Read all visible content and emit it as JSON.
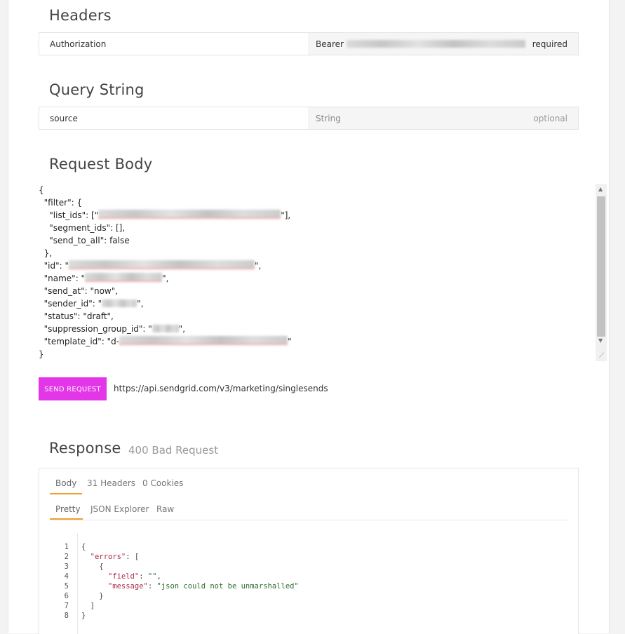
{
  "headers": {
    "title": "Headers",
    "rows": [
      {
        "name": "Authorization",
        "value": "Bearer",
        "requirement": "required"
      }
    ]
  },
  "query": {
    "title": "Query String",
    "rows": [
      {
        "name": "source",
        "value": "String",
        "requirement": "optional"
      }
    ]
  },
  "request_body": {
    "title": "Request Body",
    "lines": {
      "l1": "{",
      "l2": "  \"filter\": {",
      "l3a": "    \"list_ids\": [\"",
      "l3b": "\"],",
      "l4": "    \"segment_ids\": [],",
      "l5": "    \"send_to_all\": false",
      "l6": "  },",
      "l7a": "  \"id\": \"",
      "l7b": "\",",
      "l8a": "  \"name\": \"",
      "l8b": "\",",
      "l9": "  \"send_at\": \"now\",",
      "l10a": "  \"sender_id\": \"",
      "l10b": "\",",
      "l11": "  \"status\": \"draft\",",
      "l12a": "  \"suppression_group_id\": \"",
      "l12b": "\",",
      "l13a": "  \"template_id\": \"d-",
      "l13b": "\"",
      "l14": "}"
    }
  },
  "send_button_label": "SEND REQUEST",
  "endpoint_url": "https://api.sendgrid.com/v3/marketing/singlesends",
  "response": {
    "title": "Response",
    "status": "400 Bad Request",
    "tabs": [
      "Body",
      "31 Headers",
      "0 Cookies"
    ],
    "view_tabs": [
      "Pretty",
      "JSON Explorer",
      "Raw"
    ],
    "line_numbers": [
      "1",
      "2",
      "3",
      "4",
      "5",
      "6",
      "7",
      "8"
    ],
    "code": {
      "l1": "{",
      "l2_key": "\"errors\"",
      "l2_rest": ": [",
      "l3": "{",
      "l4_key": "\"field\"",
      "l4_val": "\"\"",
      "l5_key": "\"message\"",
      "l5_val": "\"json could not be unmarshalled\"",
      "l6": "}",
      "l7": "]",
      "l8": "}"
    }
  },
  "colors": {
    "send_button": "#e336e8",
    "active_tab_underline": "#f0a030"
  }
}
